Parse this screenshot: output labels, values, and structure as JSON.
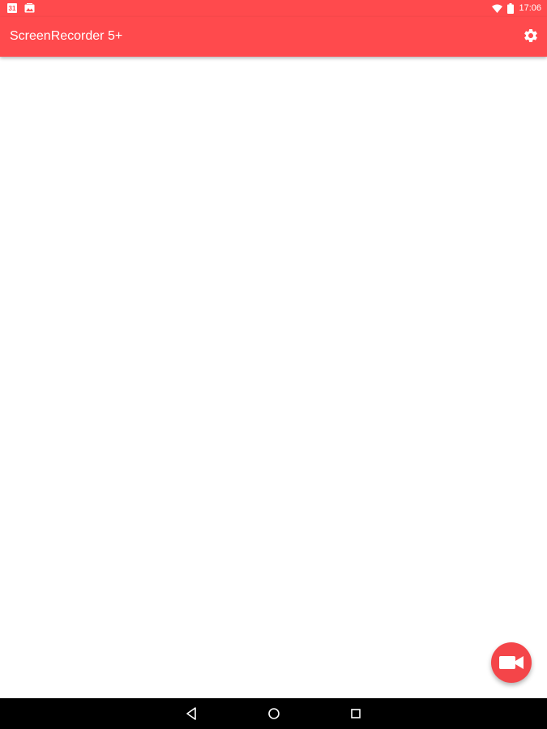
{
  "status_bar": {
    "time": "17:06",
    "calendar_day": "31",
    "icons": [
      "calendar-icon",
      "gallery-notification-icon",
      "wifi-icon",
      "battery-icon"
    ]
  },
  "app_bar": {
    "title": "ScreenRecorder 5+",
    "settings_icon": "gear-icon"
  },
  "fab": {
    "icon": "videocam-icon"
  },
  "nav_bar": {
    "buttons": [
      "back-icon",
      "home-icon",
      "recents-icon"
    ]
  },
  "colors": {
    "primary": "#ff4a4d",
    "fab": "#f44549",
    "background": "#ffffff",
    "nav_bar": "#000000"
  }
}
